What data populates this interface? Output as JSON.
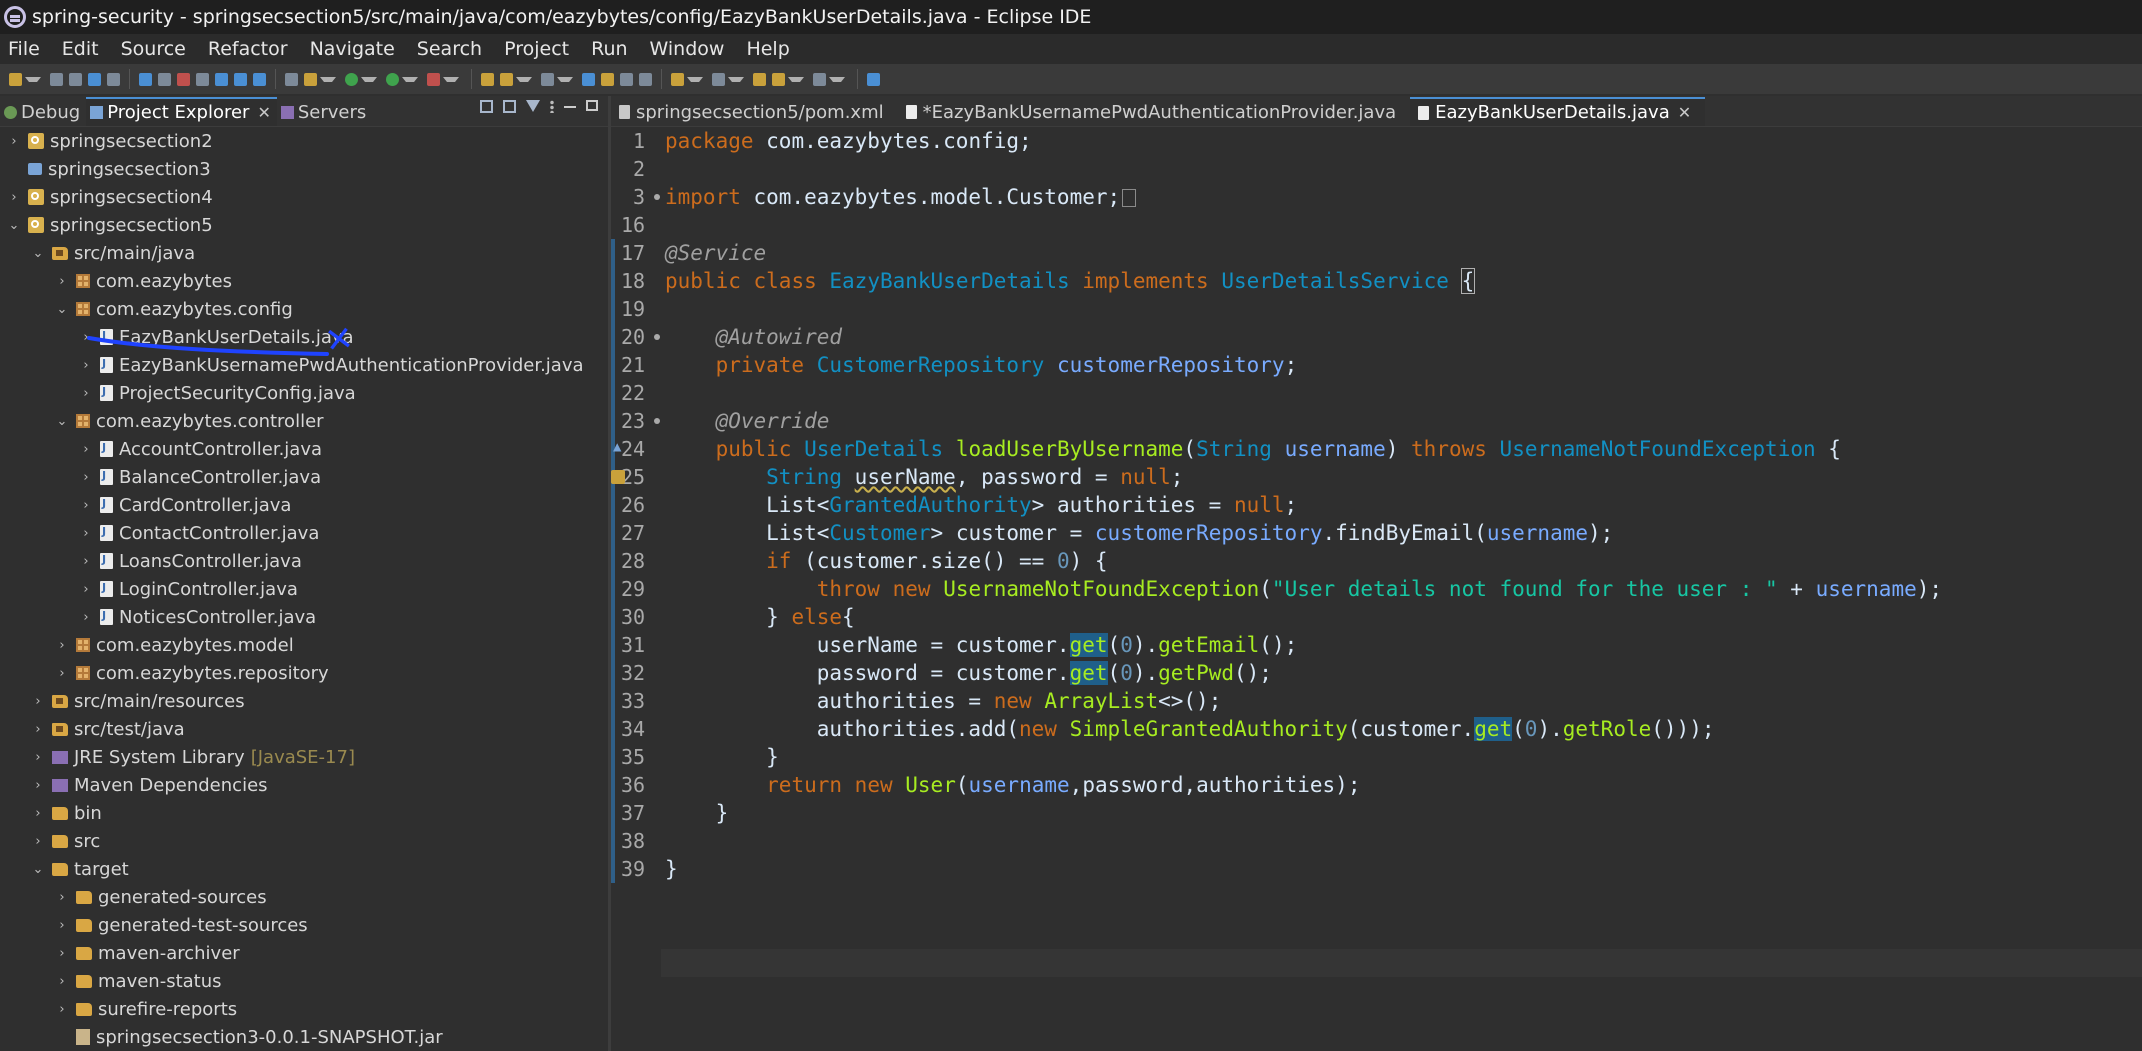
{
  "window": {
    "title": "spring-security - springsecsection5/src/main/java/com/eazybytes/config/EazyBankUserDetails.java - Eclipse IDE"
  },
  "menu": [
    "File",
    "Edit",
    "Source",
    "Refactor",
    "Navigate",
    "Search",
    "Project",
    "Run",
    "Window",
    "Help"
  ],
  "left_tabs": [
    {
      "label": "Debug",
      "icon": "debug-icon",
      "active": false
    },
    {
      "label": "Project Explorer",
      "icon": "project-explorer-icon",
      "active": true
    },
    {
      "label": "Servers",
      "icon": "servers-icon",
      "active": false
    }
  ],
  "tree": [
    {
      "label": "springsecsection2",
      "icon": "project-icon",
      "twisty": ">"
    },
    {
      "label": "springsecsection3",
      "icon": "closed-project-icon",
      "twisty": ""
    },
    {
      "label": "springsecsection4",
      "icon": "project-icon",
      "twisty": ">"
    },
    {
      "label": "springsecsection5",
      "icon": "project-icon",
      "twisty": "v"
    },
    {
      "label": "src/main/java",
      "icon": "source-folder-icon",
      "twisty": "v"
    },
    {
      "label": "com.eazybytes",
      "icon": "package-icon",
      "twisty": ">"
    },
    {
      "label": "com.eazybytes.config",
      "icon": "package-icon",
      "twisty": "v"
    },
    {
      "label": "EazyBankUserDetails.java",
      "icon": "java-file-icon",
      "twisty": ">"
    },
    {
      "label": "EazyBankUsernamePwdAuthenticationProvider.java",
      "icon": "java-file-icon",
      "twisty": ">"
    },
    {
      "label": "ProjectSecurityConfig.java",
      "icon": "java-file-icon",
      "twisty": ">"
    },
    {
      "label": "com.eazybytes.controller",
      "icon": "package-icon",
      "twisty": "v"
    },
    {
      "label": "AccountController.java",
      "icon": "java-file-icon",
      "twisty": ">"
    },
    {
      "label": "BalanceController.java",
      "icon": "java-file-icon",
      "twisty": ">"
    },
    {
      "label": "CardController.java",
      "icon": "java-file-icon",
      "twisty": ">"
    },
    {
      "label": "ContactController.java",
      "icon": "java-file-icon",
      "twisty": ">"
    },
    {
      "label": "LoansController.java",
      "icon": "java-file-icon",
      "twisty": ">"
    },
    {
      "label": "LoginController.java",
      "icon": "java-file-icon",
      "twisty": ">"
    },
    {
      "label": "NoticesController.java",
      "icon": "java-file-icon",
      "twisty": ">"
    },
    {
      "label": "com.eazybytes.model",
      "icon": "package-icon",
      "twisty": ">"
    },
    {
      "label": "com.eazybytes.repository",
      "icon": "package-icon",
      "twisty": ">"
    },
    {
      "label": "src/main/resources",
      "icon": "source-folder-icon",
      "twisty": ">"
    },
    {
      "label": "src/test/java",
      "icon": "source-folder-icon",
      "twisty": ">"
    },
    {
      "label": "JRE System Library",
      "suffix": "[JavaSE-17]",
      "icon": "library-icon",
      "twisty": ">"
    },
    {
      "label": "Maven Dependencies",
      "icon": "library-icon",
      "twisty": ">"
    },
    {
      "label": "bin",
      "icon": "folder-icon",
      "twisty": ">"
    },
    {
      "label": "src",
      "icon": "folder-icon",
      "twisty": ">"
    },
    {
      "label": "target",
      "icon": "folder-icon",
      "twisty": "v"
    },
    {
      "label": "generated-sources",
      "icon": "folder-icon",
      "twisty": ">"
    },
    {
      "label": "generated-test-sources",
      "icon": "folder-icon",
      "twisty": ">"
    },
    {
      "label": "maven-archiver",
      "icon": "folder-icon",
      "twisty": ">"
    },
    {
      "label": "maven-status",
      "icon": "folder-icon",
      "twisty": ">"
    },
    {
      "label": "surefire-reports",
      "icon": "folder-icon",
      "twisty": ">"
    },
    {
      "label": "springsecsection3-0.0.1-SNAPSHOT.jar",
      "icon": "jar-icon",
      "twisty": ""
    }
  ],
  "editor_tabs": [
    {
      "label": "springsecsection5/pom.xml",
      "icon": "xml-file-icon",
      "active": false
    },
    {
      "label": "*EazyBankUsernamePwdAuthenticationProvider.java",
      "icon": "java-file-icon",
      "active": false
    },
    {
      "label": "EazyBankUserDetails.java",
      "icon": "java-file-icon",
      "active": true
    }
  ],
  "code": {
    "line_numbers": [
      "1",
      "2",
      "3",
      "16",
      "17",
      "18",
      "19",
      "20",
      "21",
      "22",
      "23",
      "24",
      "25",
      "26",
      "27",
      "28",
      "29",
      "30",
      "31",
      "32",
      "33",
      "34",
      "35",
      "36",
      "37",
      "38",
      "39"
    ],
    "tokens": {
      "package_kw": "package",
      "package_name": " com.eazybytes.config;",
      "import_kw": "import",
      "import_name": " com.eazybytes.model.Customer;",
      "service_ann": "@Service",
      "public1": "public",
      "class_kw": "class",
      "class_name": "EazyBankUserDetails",
      "implements_kw": "implements",
      "iface": "UserDetailsService",
      "brace_open": "{",
      "autowired_ann": "@Autowired",
      "private_kw": "private",
      "repo_type": "CustomerRepository",
      "repo_field": "customerRepository",
      "semi": ";",
      "override_ann": "@Override",
      "public2": "public",
      "ret_type": "UserDetails",
      "method_name": "loadUserByUsername",
      "string_type": "String",
      "username_param": "username",
      "throws_kw": "throws",
      "exception_type": "UsernameNotFoundException",
      "l25_string": "String",
      "l25_userName": "userName",
      "l25_mid": ", password = ",
      "null_kw": "null",
      "l26_list": "List<",
      "l26_type": "GrantedAuthority",
      "l26_rest": "> authorities = ",
      "l27_list": "List<",
      "l27_type": "Customer",
      "l27_mid": "> customer = ",
      "l27_field": "customerRepository",
      "l27_call": ".findByEmail(",
      "l27_end": ");",
      "if_kw": "if",
      "l28_mid": " (customer.size() == ",
      "zero": "0",
      "l28_end": ") {",
      "throw_kw": "throw",
      "new_kw": "new",
      "l29_exc": "UsernameNotFoundException",
      "l29_str": "\"User details not found for the user : \"",
      "l29_plus": " + ",
      "l29_end": ");",
      "l30_close": "} ",
      "else_kw": "else",
      "l30_brace": "{",
      "l31_a": "userName = customer.",
      "get_kw": "get",
      "l31_b": ").",
      "getEmail": "getEmail",
      "call_end": "();",
      "l32_a": "password = customer.",
      "getPwd": "getPwd",
      "l33_a": "authorities = ",
      "arraylist": "ArrayList",
      "l33_end": "<>();",
      "l34_a": "authorities.add(",
      "l34_type": "SimpleGrantedAuthority",
      "l34_b": "(customer.",
      "getRole": "getRole",
      "l34_end": "()));",
      "l35": "}",
      "return_kw": "return",
      "user_type": "User",
      "l36_args": "password,authorities);",
      "l37": "}",
      "l39": "}"
    }
  },
  "colors": {
    "keyword": "#cc6c1d",
    "type": "#1290c3",
    "string": "#17c6a3",
    "number": "#6897bb",
    "parameter": "#79abff",
    "method": "#a7ec21",
    "annotation": "#a0a0a0",
    "annotation_pen": "#1f43ff"
  }
}
